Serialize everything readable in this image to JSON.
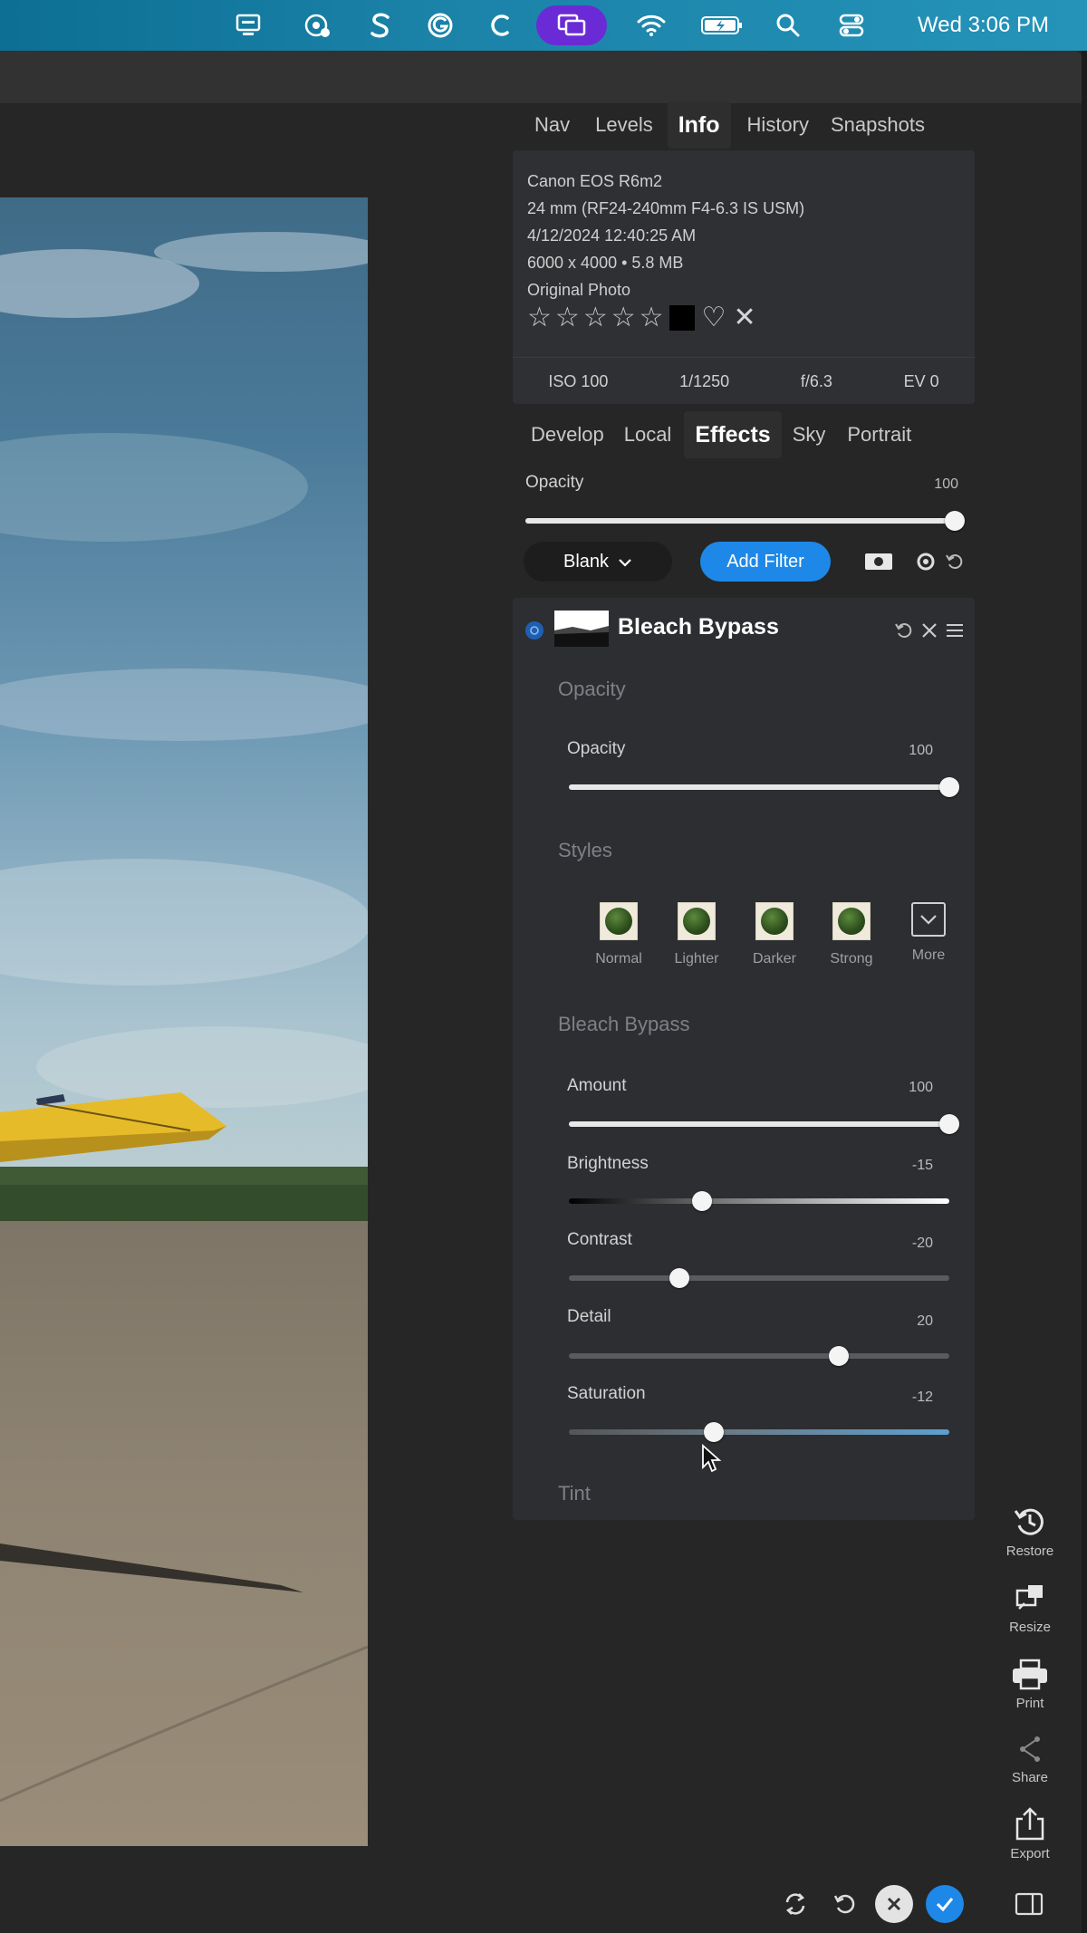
{
  "menubar": {
    "clock": "Wed 3:06 PM",
    "icons": [
      "monitor-icon",
      "browser-badge-icon",
      "s-app-icon",
      "grammarly-icon",
      "c-app-icon",
      "screen-mirror-icon",
      "wifi-icon",
      "battery-icon",
      "search-icon",
      "control-center-icon"
    ]
  },
  "top_tabs": [
    "Nav",
    "Levels",
    "Info",
    "History",
    "Snapshots"
  ],
  "info": {
    "camera": "Canon EOS R6m2",
    "lens": "24 mm (RF24-240mm F4-6.3 IS USM)",
    "date": "4/12/2024 12:40:25 AM",
    "size": "6000 x 4000 • 5.8 MB",
    "type": "Original Photo",
    "stars": [
      "☆",
      "☆",
      "☆",
      "☆",
      "☆"
    ],
    "heart": "♡",
    "reject": "✕",
    "exif": [
      "ISO 100",
      "1/1250",
      "f/6.3",
      "EV 0"
    ]
  },
  "mode_tabs": [
    "Develop",
    "Local",
    "Effects",
    "Sky",
    "Portrait"
  ],
  "global_opacity": {
    "label": "Opacity",
    "value": "100",
    "level": 1.0
  },
  "toolbar": {
    "preset_label": "Blank",
    "preset_chevron": "⌄",
    "add_filter_label": "Add Filter"
  },
  "filter": {
    "name": "Bleach Bypass",
    "opacity_section": "Opacity",
    "opacity": {
      "label": "Opacity",
      "value": "100",
      "level": 1.0
    },
    "styles_section": "Styles",
    "styles": [
      "Normal",
      "Lighter",
      "Darker",
      "Strong",
      "More"
    ],
    "bypass_section": "Bleach Bypass",
    "sliders": [
      {
        "label": "Amount",
        "value": "100",
        "level": 1.0
      },
      {
        "label": "Brightness",
        "value": "-15",
        "level": 0.35
      },
      {
        "label": "Contrast",
        "value": "-20",
        "level": 0.29
      },
      {
        "label": "Detail",
        "value": "20",
        "level": 0.71
      },
      {
        "label": "Saturation",
        "value": "-12",
        "level": 0.38
      }
    ],
    "tint_section": "Tint"
  },
  "rail": [
    "Restore",
    "Resize",
    "Print",
    "Share",
    "Export"
  ],
  "colors": {
    "accent": "#1e88e8",
    "panel": "#2d2e31",
    "background": "#262626"
  }
}
